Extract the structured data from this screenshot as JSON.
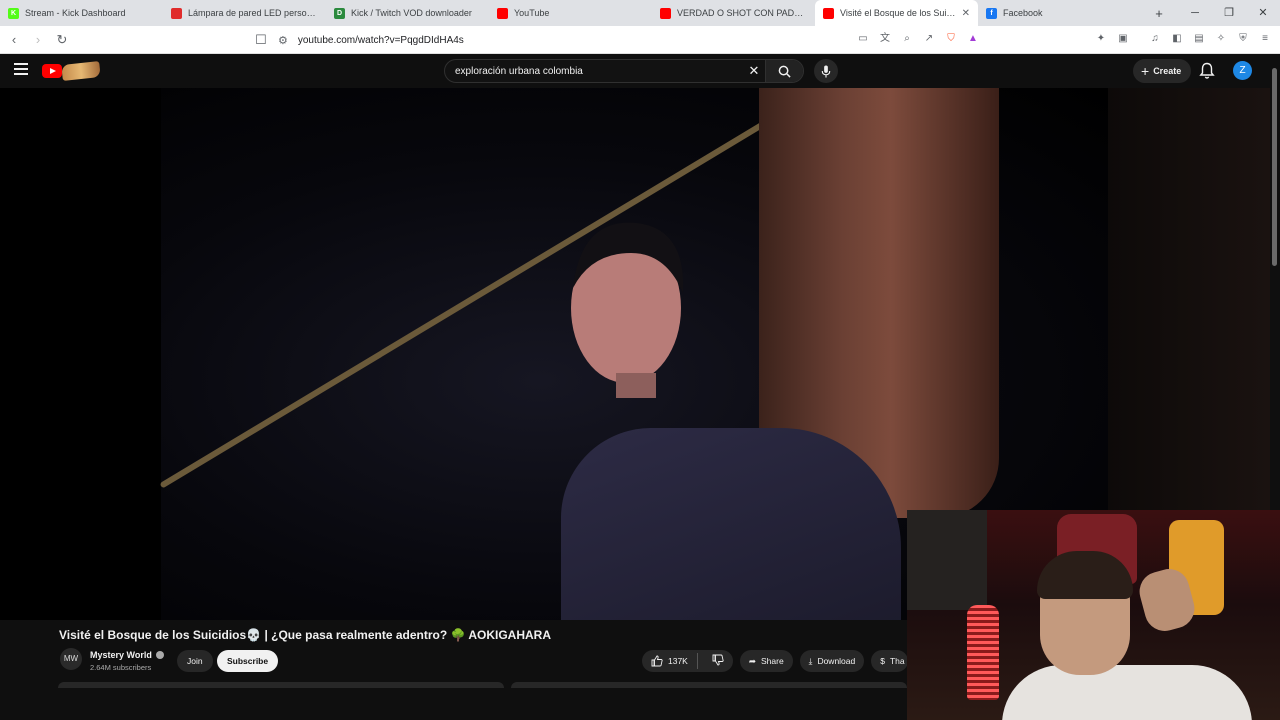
{
  "browser": {
    "tabs": [
      {
        "title": "Stream - Kick Dashboard",
        "fav_color": "#53fc18",
        "fav_char": "K",
        "active": false
      },
      {
        "title": "Lámpara de pared LED personalizada",
        "fav_color": "#e02b2b",
        "fav_char": "",
        "active": false
      },
      {
        "title": "Kick / Twitch VOD downloader",
        "fav_color": "#2b8a3e",
        "fav_char": "D",
        "active": false
      },
      {
        "title": "YouTube",
        "fav_color": "#ff0000",
        "fav_char": "",
        "active": false
      },
      {
        "title": "VERDAD O SHOT CON PADRES PARTE",
        "fav_color": "#ff0000",
        "fav_char": "",
        "active": false
      },
      {
        "title": "Visité el Bosque de los Suicidios",
        "fav_color": "#ff0000",
        "fav_char": "",
        "active": true
      },
      {
        "title": "Facebook",
        "fav_color": "#1877f2",
        "fav_char": "f",
        "active": false
      }
    ],
    "new_tab_symbol": "+",
    "url": "youtube.com/watch?v=PqgdDIdHA4s"
  },
  "youtube": {
    "search_query": "exploración urbana colombia",
    "create_label": "Create",
    "avatar_letter": "Z"
  },
  "video": {
    "title": "Visité el Bosque de los Suicidios💀 | ¿Que pasa realmente adentro? 🌳 AOKIGAHARA",
    "channel_name": "Mystery World",
    "channel_avatar_text": "MW",
    "subscribers": "2.64M subscribers",
    "join_label": "Join",
    "subscribe_label": "Subscribe",
    "likes": "137K",
    "share_label": "Share",
    "download_label": "Download",
    "thanks_label": "Tha"
  }
}
